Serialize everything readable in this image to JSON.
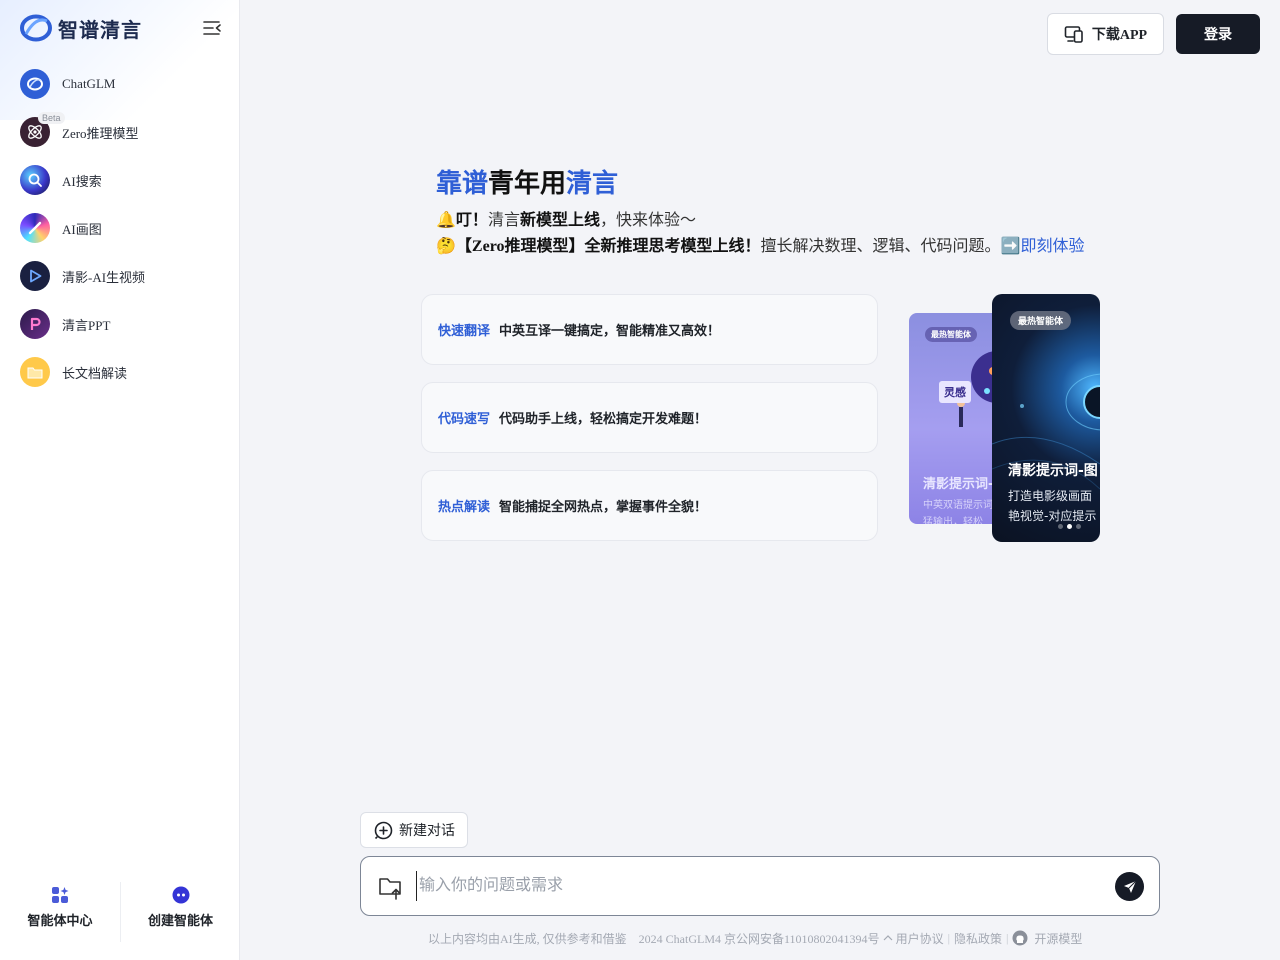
{
  "brand": {
    "name": "智谱清言"
  },
  "sidebar": {
    "items": [
      {
        "label": "ChatGLM",
        "icon": "chatglm-icon"
      },
      {
        "label": "Zero推理模型",
        "icon": "zero-model-icon",
        "badge": "Beta"
      },
      {
        "label": "AI搜索",
        "icon": "ai-search-icon"
      },
      {
        "label": "AI画图",
        "icon": "ai-draw-icon"
      },
      {
        "label": "清影-AI生视频",
        "icon": "video-play-icon"
      },
      {
        "label": "清言PPT",
        "icon": "ppt-icon"
      },
      {
        "label": "长文档解读",
        "icon": "folder-icon"
      }
    ],
    "bottom": {
      "agent_center": "智能体中心",
      "create_agent": "创建智能体"
    }
  },
  "header": {
    "download_label": "下载APP",
    "login_label": "登录"
  },
  "hero": {
    "slogan": {
      "part1": "靠谱",
      "part2": "青年用",
      "part3": "清言"
    },
    "notice1": {
      "emoji": "🔔",
      "bold1": "叮！",
      "text1": "清言",
      "bold2": "新模型上线",
      "text2": "，快来体验～"
    },
    "notice2": {
      "emoji": "🤔",
      "bold": "【Zero推理模型】全新推理思考模型上线！",
      "text": "擅长解决数理、逻辑、代码问题。",
      "arrow": "➡️",
      "link": "即刻体验"
    }
  },
  "cards": [
    {
      "tag": "快速翻译",
      "desc": "中英互译一键搞定，智能精准又高效！"
    },
    {
      "tag": "代码速写",
      "desc": "代码助手上线，轻松搞定开发难题！"
    },
    {
      "tag": "热点解读",
      "desc": "智能捕捉全网热点，掌握事件全貌！"
    }
  ],
  "carousel": {
    "back": {
      "badge": "最热智能体",
      "title": "清影提示词-",
      "line1": "中英双语提示词",
      "line2": "猛输出，轻松",
      "sign": "灵感"
    },
    "front": {
      "badge": "最热智能体",
      "title": "清影提示词-图",
      "line1": "打造电影级画面",
      "line2": "艳视觉-对应提示"
    },
    "active_slide": 2,
    "slide_count": 3
  },
  "chat": {
    "new_chat_label": "新建对话",
    "placeholder": "输入你的问题或需求"
  },
  "footer": {
    "disclaimer": "以上内容均由AI生成, 仅供参考和借鉴",
    "icp": "2024 ChatGLM4 京公网安备11010802041394号",
    "user_agreement": "用户协议",
    "privacy": "隐私政策",
    "open_source": "开源模型"
  },
  "colors": {
    "accent": "#2f5fd6",
    "dark_button": "#161b26",
    "background": "#f3f4f8"
  }
}
